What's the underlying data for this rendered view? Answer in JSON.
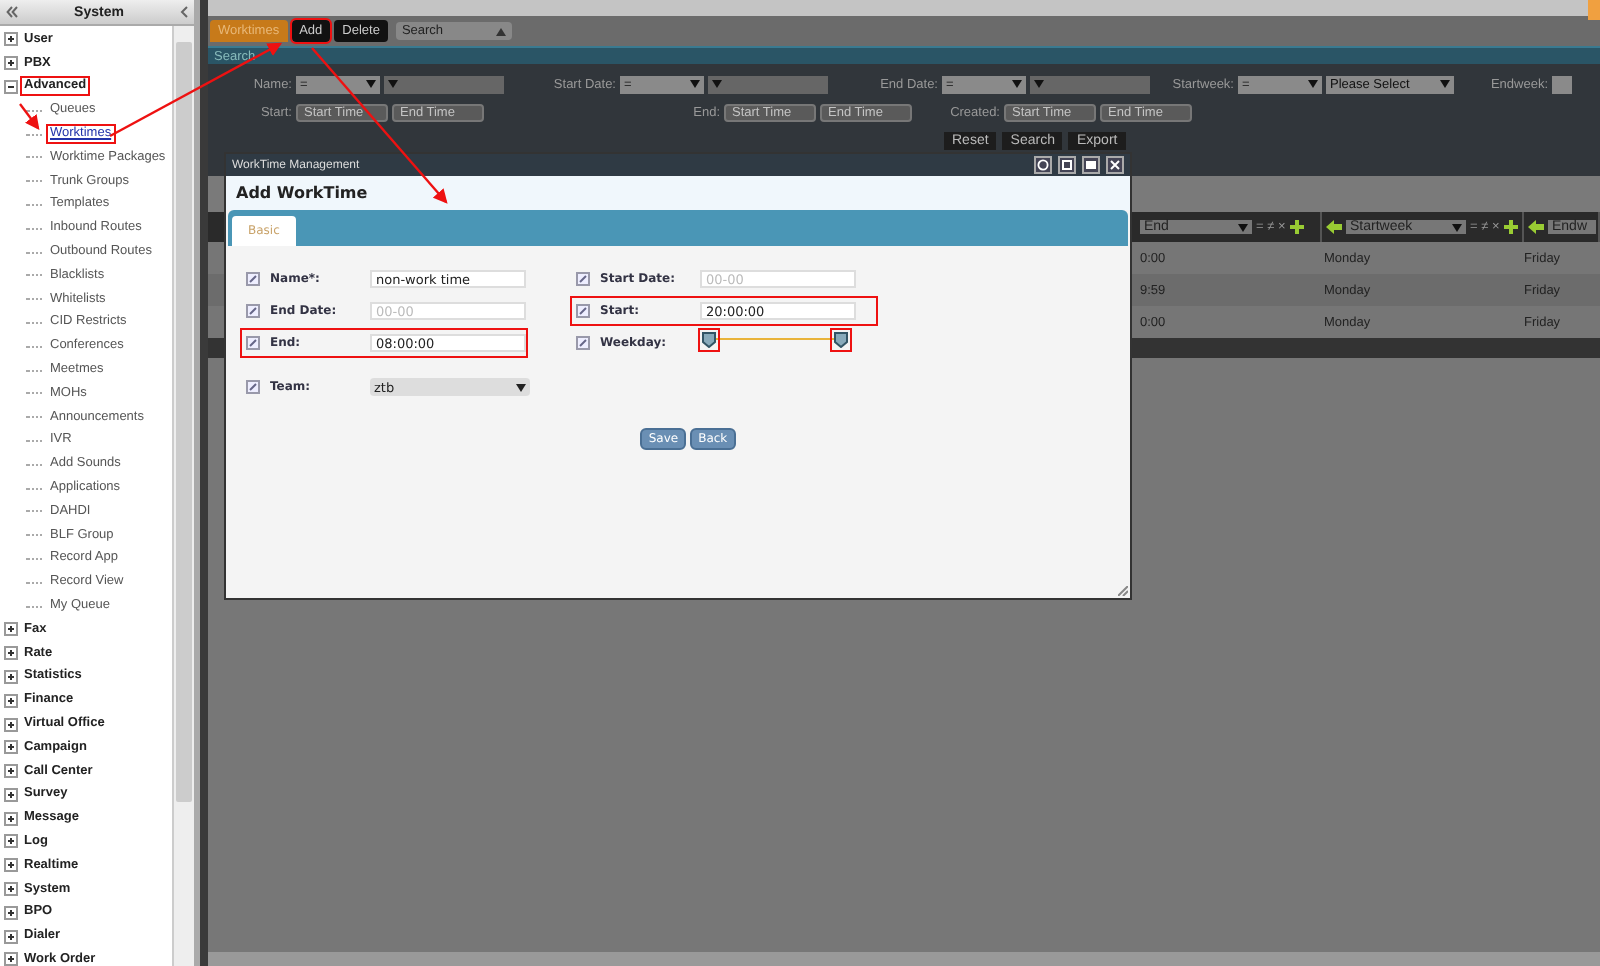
{
  "sidebar": {
    "title": "System",
    "items": [
      {
        "label": "User",
        "expanded": false
      },
      {
        "label": "PBX",
        "expanded": false
      },
      {
        "label": "Advanced",
        "expanded": true,
        "highlighted": true,
        "children": [
          {
            "label": "Queues",
            "selected": false
          },
          {
            "label": "Worktimes",
            "selected": true,
            "highlighted": true
          },
          {
            "label": "Worktime Packages",
            "selected": false
          },
          {
            "label": "Trunk Groups",
            "selected": false
          },
          {
            "label": "Templates",
            "selected": false
          },
          {
            "label": "Inbound Routes",
            "selected": false
          },
          {
            "label": "Outbound Routes",
            "selected": false
          },
          {
            "label": "Blacklists",
            "selected": false
          },
          {
            "label": "Whitelists",
            "selected": false
          },
          {
            "label": "CID Restricts",
            "selected": false
          },
          {
            "label": "Conferences",
            "selected": false
          },
          {
            "label": "Meetmes",
            "selected": false
          },
          {
            "label": "MOHs",
            "selected": false
          },
          {
            "label": "Announcements",
            "selected": false
          },
          {
            "label": "IVR",
            "selected": false
          },
          {
            "label": "Add Sounds",
            "selected": false
          },
          {
            "label": "Applications",
            "selected": false
          },
          {
            "label": "DAHDI",
            "selected": false
          },
          {
            "label": "BLF Group",
            "selected": false
          },
          {
            "label": "Record App",
            "selected": false
          },
          {
            "label": "Record View",
            "selected": false
          },
          {
            "label": "My Queue",
            "selected": false
          }
        ]
      },
      {
        "label": "Fax",
        "expanded": false
      },
      {
        "label": "Rate",
        "expanded": false
      },
      {
        "label": "Statistics",
        "expanded": false
      },
      {
        "label": "Finance",
        "expanded": false
      },
      {
        "label": "Virtual Office",
        "expanded": false
      },
      {
        "label": "Campaign",
        "expanded": false
      },
      {
        "label": "Call Center",
        "expanded": false
      },
      {
        "label": "Survey",
        "expanded": false
      },
      {
        "label": "Message",
        "expanded": false
      },
      {
        "label": "Log",
        "expanded": false
      },
      {
        "label": "Realtime",
        "expanded": false
      },
      {
        "label": "System",
        "expanded": false
      },
      {
        "label": "BPO",
        "expanded": false
      },
      {
        "label": "Dialer",
        "expanded": false
      },
      {
        "label": "Work Order",
        "expanded": false
      }
    ]
  },
  "toolbar": {
    "buttons": [
      {
        "label": "Worktimes",
        "kind": "tab"
      },
      {
        "label": "Add",
        "kind": "button",
        "highlighted": true
      },
      {
        "label": "Delete",
        "kind": "button"
      }
    ],
    "search_select": "Search"
  },
  "search_panel": {
    "title": "Search",
    "row_1": [
      {
        "label": "Name:",
        "operator": "="
      },
      {
        "label": "Start Date:",
        "operator": "="
      },
      {
        "label": "End Date:",
        "operator": "="
      },
      {
        "label": "Startweek:",
        "operator": "=",
        "value": "Please Select"
      },
      {
        "label": "Endweek:"
      }
    ],
    "row_2": [
      {
        "label": "Start:",
        "fields": [
          {
            "placeholder": "Start Time"
          },
          {
            "placeholder": "End Time"
          }
        ]
      },
      {
        "label": "End:",
        "fields": [
          {
            "placeholder": "Start Time"
          },
          {
            "placeholder": "End Time"
          }
        ]
      },
      {
        "label": "Created:",
        "fields": [
          {
            "placeholder": "Start Time"
          },
          {
            "placeholder": "End Time"
          }
        ]
      }
    ],
    "buttons": [
      "Reset",
      "Search",
      "Export"
    ]
  },
  "table": {
    "columns": [
      {
        "label": "End",
        "filter": "= ≠ ×"
      },
      {
        "label": "Startweek",
        "filter": "= ≠ ×"
      },
      {
        "label": "Endw"
      }
    ],
    "rows": [
      [
        "0:00",
        "Monday",
        "Friday"
      ],
      [
        "9:59",
        "Monday",
        "Friday"
      ],
      [
        "0:00",
        "Monday",
        "Friday"
      ]
    ]
  },
  "dialog": {
    "title": "WorkTime Management",
    "heading": "Add WorkTime",
    "tabs": [
      {
        "label": "Basic",
        "selected": true
      }
    ],
    "left_fields": [
      {
        "kind": "text",
        "label": "Name*:",
        "value": "non-work time"
      },
      {
        "kind": "text",
        "label": "End Date:",
        "placeholder": "00-00"
      },
      {
        "kind": "text",
        "label": "End:",
        "value": "08:00:00",
        "highlighted": true
      },
      {
        "kind": "select",
        "label": "Team:",
        "value": "ztb"
      }
    ],
    "right_fields": [
      {
        "kind": "text",
        "label": "Start Date:",
        "placeholder": "00-00"
      },
      {
        "kind": "text",
        "label": "Start:",
        "value": "20:00:00",
        "highlighted": true
      },
      {
        "kind": "range",
        "label": "Weekday:",
        "handles": [
          {
            "level": 0,
            "highlighted": true
          },
          {
            "level": 1,
            "highlighted": true
          }
        ]
      }
    ],
    "buttons": [
      "Save",
      "Back"
    ]
  }
}
